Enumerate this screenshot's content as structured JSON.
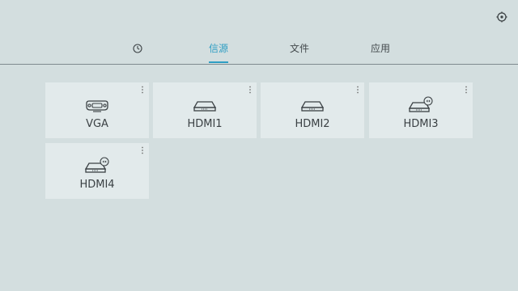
{
  "header": {
    "settings_icon": "settings-gear-icon",
    "tabs": [
      {
        "label": "",
        "icon": "clock-icon",
        "active": false
      },
      {
        "label": "信源",
        "active": true
      },
      {
        "label": "文件",
        "active": false
      },
      {
        "label": "应用",
        "active": false
      }
    ]
  },
  "sources": [
    {
      "label": "VGA",
      "icon": "vga-connector-icon"
    },
    {
      "label": "HDMI1",
      "icon": "hdmi-device-icon"
    },
    {
      "label": "HDMI2",
      "icon": "hdmi-device-icon"
    },
    {
      "label": "HDMI3",
      "icon": "hdmi-device-badge-icon"
    },
    {
      "label": "HDMI4",
      "icon": "hdmi-device-badge-icon"
    }
  ],
  "colors": {
    "background": "#d3dedf",
    "card": "#e2eaeb",
    "accent": "#2f9ec3",
    "text": "#3b4144"
  }
}
